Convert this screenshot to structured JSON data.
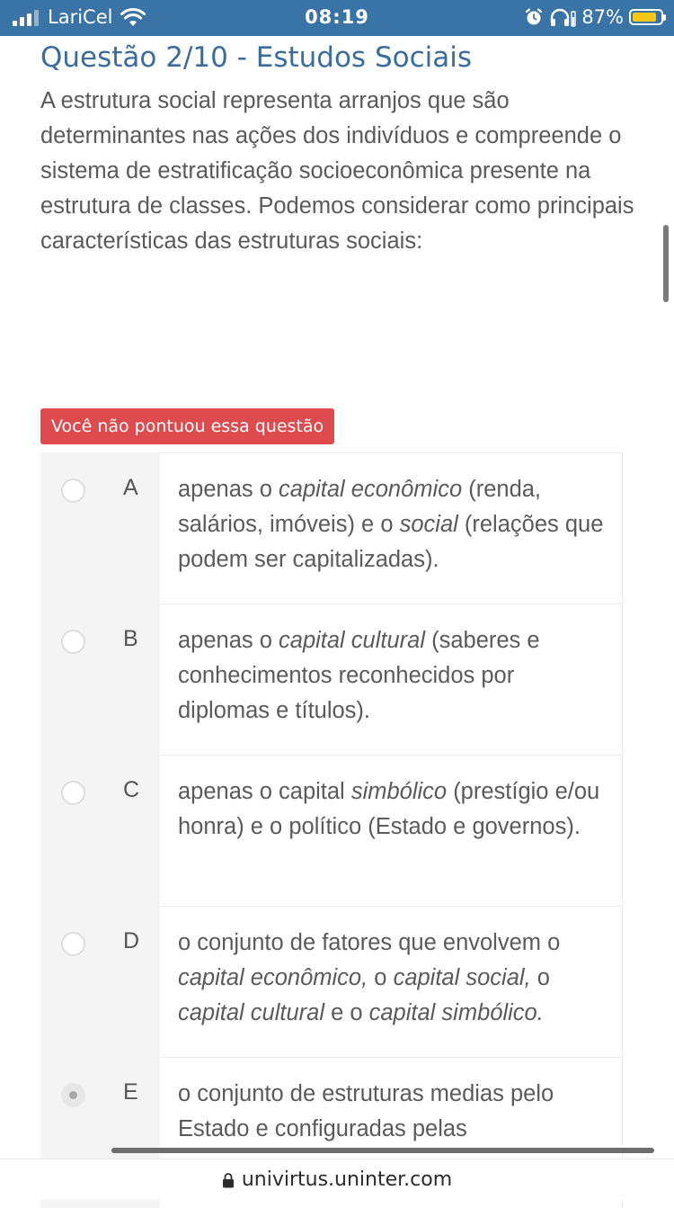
{
  "status_bar": {
    "carrier": "LariCel",
    "time": "08:19",
    "battery_percent": "87%",
    "battery_level": 0.87,
    "icons": [
      "signal-icon",
      "wifi-icon",
      "alarm-icon",
      "headphones-icon",
      "battery-icon"
    ]
  },
  "question": {
    "title": "Questão 2/10 - Estudos Sociais",
    "text": "A estrutura social representa arranjos que são determinantes nas ações dos indivíduos e compreende o sistema de estratificação socioeconômica presente na estrutura de classes. Podemos considerar como principais características das estruturas sociais:",
    "result_badge": "Você não pontuou essa questão"
  },
  "options": [
    {
      "letter": "A",
      "selected": false,
      "segments": [
        {
          "text": "apenas o ",
          "italic": false
        },
        {
          "text": "capital econômico",
          "italic": true
        },
        {
          "text": " (renda, salários, imóveis) e o ",
          "italic": false
        },
        {
          "text": "social",
          "italic": true
        },
        {
          "text": " (relações que podem ser capitalizadas).",
          "italic": false
        }
      ]
    },
    {
      "letter": "B",
      "selected": false,
      "segments": [
        {
          "text": "apenas o ",
          "italic": false
        },
        {
          "text": "capital cultural",
          "italic": true
        },
        {
          "text": " (saberes e conhecimentos reconhecidos por diplomas e títulos).",
          "italic": false
        }
      ]
    },
    {
      "letter": "C",
      "selected": false,
      "segments": [
        {
          "text": "apenas o capital ",
          "italic": false
        },
        {
          "text": "simbólico",
          "italic": true
        },
        {
          "text": " (prestígio e/ou honra) e o político (Estado e governos).",
          "italic": false
        }
      ]
    },
    {
      "letter": "D",
      "selected": false,
      "segments": [
        {
          "text": "o conjunto de fatores que envolvem o ",
          "italic": false
        },
        {
          "text": "capital econômico,",
          "italic": true
        },
        {
          "text": " o ",
          "italic": false
        },
        {
          "text": "capital social,",
          "italic": true
        },
        {
          "text": " o ",
          "italic": false
        },
        {
          "text": "capital cultural",
          "italic": true
        },
        {
          "text": " e o ",
          "italic": false
        },
        {
          "text": "capital simbólico.",
          "italic": true
        }
      ]
    },
    {
      "letter": "E",
      "selected": true,
      "segments": [
        {
          "text": "o conjunto de estruturas medias pelo Estado e configuradas pelas",
          "italic": false
        }
      ]
    }
  ],
  "browser": {
    "url": "univirtus.uninter.com",
    "lock_icon": "lock-icon"
  },
  "colors": {
    "status_bar": "#3a73a6",
    "title": "#3b6d9c",
    "badge": "#dd4b4e",
    "battery_fill": "#f5c518"
  }
}
